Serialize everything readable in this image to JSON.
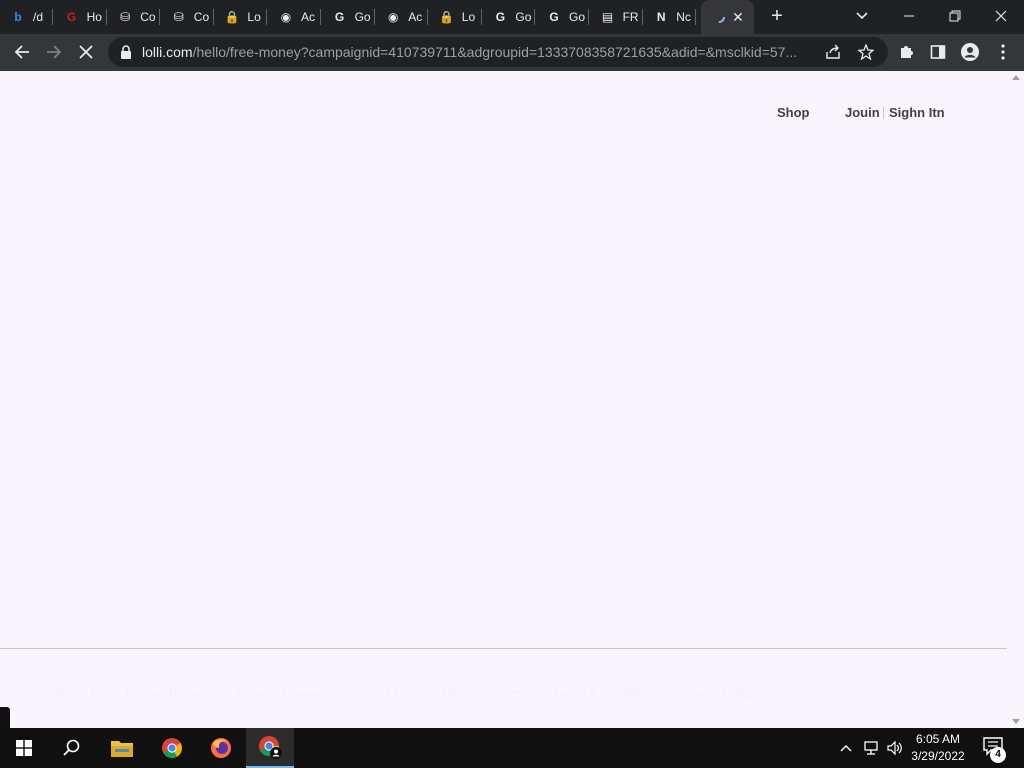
{
  "browser": {
    "tabs": [
      {
        "title": "/d",
        "icon": "bing-icon",
        "color": "#2a8fe6"
      },
      {
        "title": "Ho",
        "icon": "gme-icon",
        "color": "#cc1f1f"
      },
      {
        "title": "Co",
        "icon": "coinbase-icon",
        "color": "#e8eaed"
      },
      {
        "title": "Co",
        "icon": "coinbase-icon",
        "color": "#e8eaed"
      },
      {
        "title": "Lo",
        "icon": "lock-icon",
        "color": "#9aa0a6"
      },
      {
        "title": "Ac",
        "icon": "globe-icon",
        "color": "#e8eaed"
      },
      {
        "title": "Go",
        "icon": "google-icon",
        "color": "#e8eaed"
      },
      {
        "title": "Ac",
        "icon": "globe-icon",
        "color": "#e8eaed"
      },
      {
        "title": "Lo",
        "icon": "lock-icon",
        "color": "#9aa0a6"
      },
      {
        "title": "Go",
        "icon": "google-icon",
        "color": "#e8eaed"
      },
      {
        "title": "Go",
        "icon": "google-icon",
        "color": "#e8eaed"
      },
      {
        "title": "FR",
        "icon": "document-icon",
        "color": "#e8eaed"
      },
      {
        "title": "Nc",
        "icon": "news-icon",
        "color": "#e8eaed"
      }
    ],
    "active_tab_icon": "loading-icon",
    "url_host": "lolli.com",
    "url_path": "/hello/free-money?campaignid=410739711&adgroupid=1333708358721635&adid=&msclkid=57..."
  },
  "page": {
    "nav": {
      "shop": "Shop",
      "join": "Jouin",
      "signin": "Sighn Itn"
    },
    "footer_links": [
      "Press Kit",
      "Partner Program",
      "Referral Rewards",
      "Shop & Earn",
      "Help",
      "Careers",
      "Terms & Conditions",
      "Privacy Policy"
    ]
  },
  "taskbar": {
    "time": "6:05 AM",
    "date": "3/29/2022",
    "notification_count": "4"
  },
  "colors": {
    "page_bg": "#faf5fd",
    "chrome_dark": "#202124",
    "chrome_toolbar": "#35363a",
    "taskbar": "#101010"
  }
}
